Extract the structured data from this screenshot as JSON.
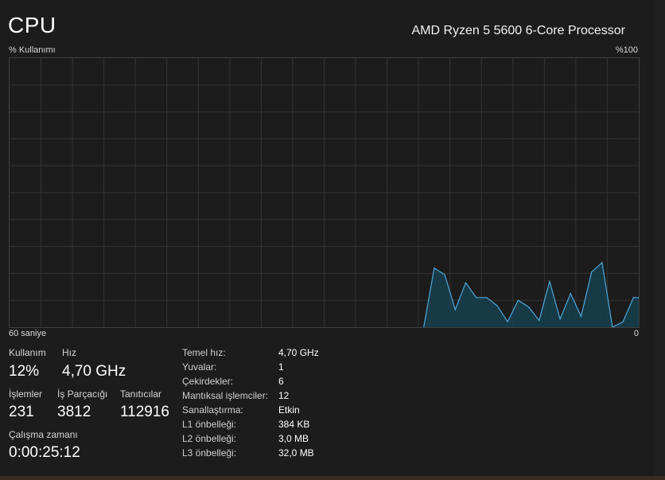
{
  "header": {
    "title": "CPU",
    "processor": "AMD Ryzen 5 5600 6-Core Processor"
  },
  "graph": {
    "y_label": "% Kullanımı",
    "y_max_label": "%100",
    "x_left_label": "60 saniye",
    "x_right_label": "0",
    "line_color": "#4fa8d8",
    "fill_color": "#16404f",
    "grid_color": "#333333"
  },
  "chart_data": {
    "type": "area",
    "xlabel": "",
    "ylabel": "% Kullanımı",
    "ylim": [
      0,
      100
    ],
    "xlim": [
      60,
      0
    ],
    "grid": true,
    "x": [
      20.5,
      19.5,
      18.5,
      17.5,
      16.5,
      15.5,
      14.5,
      13.5,
      12.5,
      11.5,
      10.5,
      9.5,
      8.5,
      7.5,
      6.5,
      5.5,
      4.5,
      3.5,
      2.5,
      1.5,
      0.5,
      0
    ],
    "values": [
      0,
      22,
      19.5,
      6.5,
      16.5,
      11,
      11,
      8,
      2,
      10,
      7.5,
      2.5,
      17,
      3,
      12.5,
      4,
      20.5,
      24,
      0,
      2,
      11,
      11
    ]
  },
  "stats": {
    "usage_label": "Kullanım",
    "usage_value": "12%",
    "speed_label": "Hız",
    "speed_value": "4,70 GHz",
    "processes_label": "İşlemler",
    "processes_value": "231",
    "threads_label": "İş Parçacığı",
    "threads_value": "3812",
    "handles_label": "Tanıtıcılar",
    "handles_value": "112916",
    "uptime_label": "Çalışma zamanı",
    "uptime_value": "0:00:25:12"
  },
  "info": {
    "rows": [
      {
        "key": "Temel hız:",
        "value": "4,70 GHz"
      },
      {
        "key": "Yuvalar:",
        "value": "1"
      },
      {
        "key": "Çekirdekler:",
        "value": "6"
      },
      {
        "key": "Mantıksal işlemciler:",
        "value": "12"
      },
      {
        "key": "Sanallaştırma:",
        "value": "Etkin"
      },
      {
        "key": "L1 önbelleği:",
        "value": "384 KB"
      },
      {
        "key": "L2 önbelleği:",
        "value": "3,0 MB"
      },
      {
        "key": "L3 önbelleği:",
        "value": "32,0 MB"
      }
    ]
  }
}
